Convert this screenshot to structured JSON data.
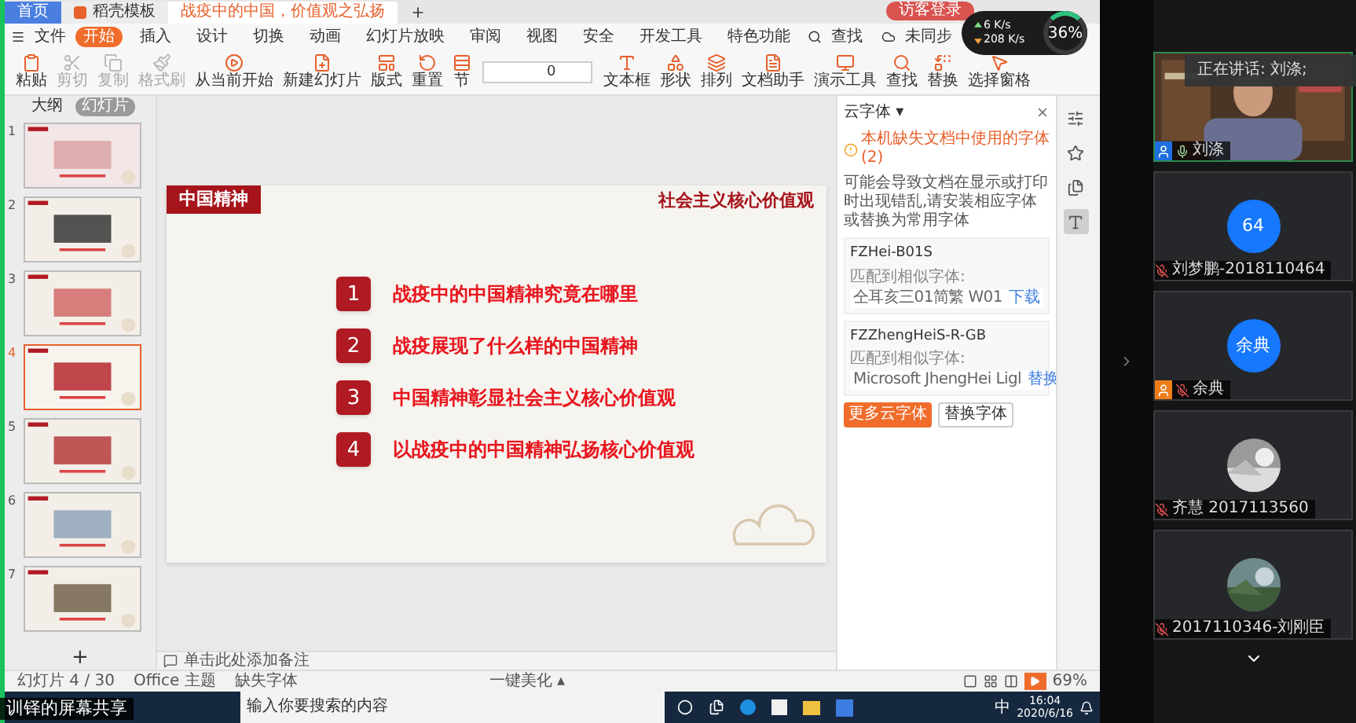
{
  "doc_tabs": [
    {
      "label": "首页",
      "kind": "home",
      "selected": false
    },
    {
      "label": "稻壳模板",
      "kind": "template",
      "selected": false
    },
    {
      "label": "战疫中的中国，价值观之弘扬",
      "kind": "doc",
      "selected": true
    }
  ],
  "guest_login": "访客登录",
  "network": {
    "up": "6 K/s",
    "down": "208 K/s",
    "percent": "36%"
  },
  "menu": {
    "file": "文件",
    "tabs": [
      {
        "label": "开始",
        "selected": true
      },
      {
        "label": "插入",
        "selected": false
      },
      {
        "label": "设计",
        "selected": false
      },
      {
        "label": "切换",
        "selected": false
      },
      {
        "label": "动画",
        "selected": false
      },
      {
        "label": "幻灯片放映",
        "selected": false
      },
      {
        "label": "审阅",
        "selected": false
      },
      {
        "label": "视图",
        "selected": false
      },
      {
        "label": "安全",
        "selected": false
      },
      {
        "label": "开发工具",
        "selected": false
      },
      {
        "label": "特色功能",
        "selected": false
      }
    ],
    "search": "查找",
    "sync": "未同步"
  },
  "ribbon": [
    {
      "label": "粘贴",
      "disabled": false
    },
    {
      "label": "剪切",
      "disabled": true
    },
    {
      "label": "复制",
      "disabled": true
    },
    {
      "label": "格式刷",
      "disabled": true
    },
    {
      "label": "从当前开始",
      "disabled": false
    },
    {
      "label": "新建幻灯片",
      "disabled": false
    },
    {
      "label": "版式",
      "disabled": false
    },
    {
      "label": "重置",
      "disabled": false
    },
    {
      "label": "节",
      "disabled": false
    },
    {
      "label": "文本框",
      "disabled": false
    },
    {
      "label": "形状",
      "disabled": false
    },
    {
      "label": "排列",
      "disabled": false
    },
    {
      "label": "文档助手",
      "disabled": false
    },
    {
      "label": "演示工具",
      "disabled": false
    },
    {
      "label": "查找",
      "disabled": false
    },
    {
      "label": "替换",
      "disabled": false
    },
    {
      "label": "选择窗格",
      "disabled": false
    }
  ],
  "font_size": "0",
  "left_panel": {
    "tabs": [
      {
        "label": "大纲",
        "selected": false
      },
      {
        "label": "幻灯片",
        "selected": true
      }
    ],
    "slides": [
      {
        "number": "1",
        "selected": false
      },
      {
        "number": "2",
        "selected": false
      },
      {
        "number": "3",
        "selected": false
      },
      {
        "number": "4",
        "selected": true
      },
      {
        "number": "5",
        "selected": false
      },
      {
        "number": "6",
        "selected": false
      },
      {
        "number": "7",
        "selected": false
      }
    ],
    "add": "+"
  },
  "slide": {
    "section": "中国精神",
    "subtitle": "社会主义核心价值观",
    "items": [
      {
        "number": "1",
        "text": "战疫中的中国精神究竟在哪里"
      },
      {
        "number": "2",
        "text": "战疫展现了什么样的中国精神"
      },
      {
        "number": "3",
        "text": "中国精神彰显社会主义核心价值观"
      },
      {
        "number": "4",
        "text": "以战疫中的中国精神弘扬核心价值观"
      }
    ]
  },
  "notes": "单击此处添加备注",
  "font_panel": {
    "title": "云字体 ▾",
    "warning": "本机缺失文档中使用的字体 (2)",
    "description": "可能会导致文档在显示或打印时出现错乱,请安装相应字体或替换为常用字体",
    "fonts": [
      {
        "name": "FZHei-B01S",
        "match_label": "匹配到相似字体:",
        "match": "仝耳亥三01简繁 W01",
        "action": "下载"
      },
      {
        "name": "FZZhengHeiS-R-GB",
        "match_label": "匹配到相似字体:",
        "match": "Microsoft JhengHei Ligl",
        "action": "替换"
      }
    ],
    "buttons": [
      {
        "label": "更多云字体",
        "primary": true
      },
      {
        "label": "替换字体",
        "primary": false
      }
    ]
  },
  "side_tools": [
    {
      "selected": false
    },
    {
      "selected": false
    },
    {
      "selected": false
    },
    {
      "selected": true
    }
  ],
  "status_bar": {
    "slide": "幻灯片 4 / 30",
    "theme": "Office 主题",
    "missing_fonts": "缺失字体",
    "beautify": "一键美化 ▴",
    "zoom": "69%"
  },
  "taskbar": {
    "search_placeholder": "输入你要搜索的内容",
    "time": "16:04",
    "date": "2020/6/16",
    "ime": "中"
  },
  "share_label": "训铎的屏幕共享",
  "meeting": {
    "speaking": "正在讲话: 刘涤;",
    "participants": [
      {
        "kind": "video",
        "name": "刘涤",
        "color": "#1e6fe0",
        "muted": false
      },
      {
        "kind": "avatar",
        "initials": "64",
        "name": "刘梦鹏-2018110464",
        "muted": true
      },
      {
        "kind": "avatar",
        "initials": "余典",
        "name": "余典",
        "color": "#f07d1a",
        "muted": true
      },
      {
        "kind": "picture",
        "name": "齐慧 2017113560",
        "muted": true
      },
      {
        "kind": "picture",
        "name": "2017110346-刘刚臣",
        "muted": true
      }
    ]
  }
}
